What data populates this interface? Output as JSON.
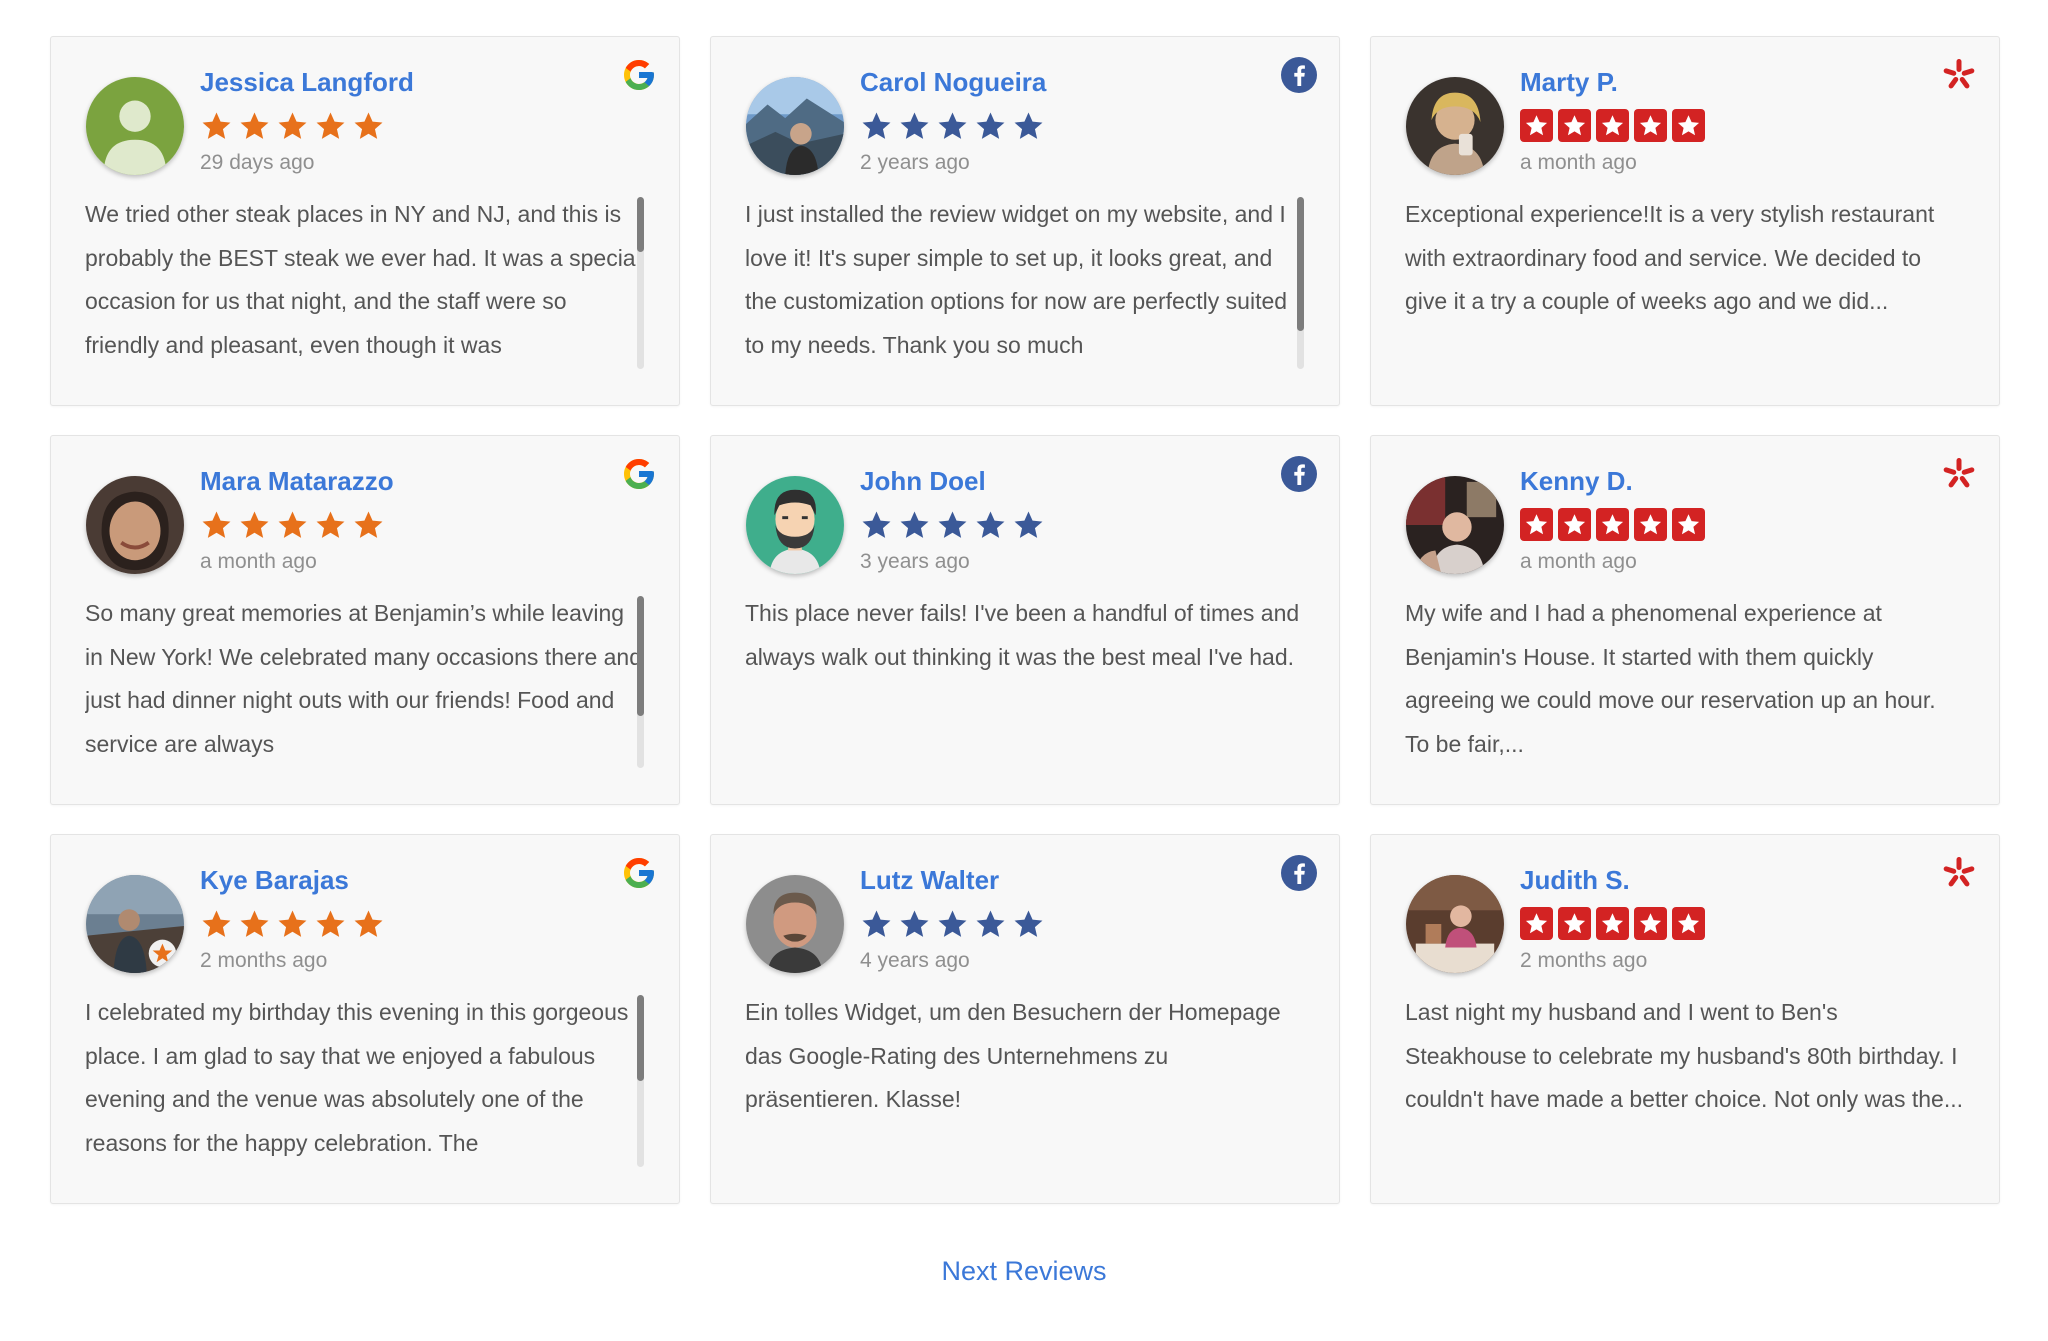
{
  "reviews": [
    {
      "name": "Jessica Langford",
      "date": "29 days ago",
      "platform": "google",
      "text": "We tried other steak places in NY and NJ, and this is probably the BEST steak we ever had. It was a special occasion for us that night, and the staff were so friendly and pleasant, even though it was",
      "scrollable": true,
      "scroll_thumb_fraction": 0.32
    },
    {
      "name": "Carol Nogueira",
      "date": "2 years ago",
      "platform": "facebook",
      "text": "I just installed the review widget on my website, and I love it! It's super simple to set up, it looks great, and the customization options for now are perfectly suited to my needs. Thank you so much",
      "scrollable": true,
      "scroll_thumb_fraction": 0.78
    },
    {
      "name": "Marty P.",
      "date": "a month ago",
      "platform": "yelp",
      "text": "Exceptional experience!It is a very stylish restaurant with extraordinary food and service. We decided to give it a try a couple of weeks ago and we did...",
      "scrollable": false
    },
    {
      "name": "Mara Matarazzo",
      "date": "a month ago",
      "platform": "google",
      "text": "So many great memories at Benjamin’s while leaving in New York! We celebrated many occasions there and just had dinner night outs with our friends! Food and service are always",
      "scrollable": true,
      "scroll_thumb_fraction": 0.7
    },
    {
      "name": "John Doel",
      "date": "3 years ago",
      "platform": "facebook",
      "text": "This place never fails! I've been a handful of times and always walk out thinking it was the best meal I've had.",
      "scrollable": false
    },
    {
      "name": "Kenny D.",
      "date": "a month ago",
      "platform": "yelp",
      "text": "My wife and I had a phenomenal experience at Benjamin's House. It started with them quickly agreeing we could move our reservation up an hour. To be fair,...",
      "scrollable": false
    },
    {
      "name": "Kye Barajas",
      "date": "2 months ago",
      "platform": "google",
      "text": "I celebrated my birthday this evening in this gorgeous place. I am glad to say that we enjoyed a fabulous evening and the venue was absolutely one of the reasons for the happy celebration. The",
      "scrollable": true,
      "scroll_thumb_fraction": 0.5
    },
    {
      "name": "Lutz Walter",
      "date": "4 years ago",
      "platform": "facebook",
      "text": "Ein tolles Widget, um den Besuchern der Homepage das Google-Rating des Unternehmens zu präsentieren. Klasse!",
      "scrollable": false
    },
    {
      "name": "Judith S.",
      "date": "2 months ago",
      "platform": "yelp",
      "text": "Last night my husband and I went to Ben's Steakhouse to celebrate my husband's 80th birthday. I couldn't have made a better choice. Not only was the...",
      "scrollable": false
    }
  ],
  "rating": 5,
  "colors": {
    "name_link": "#3b78d8",
    "google_star": "#e7711b",
    "facebook_star": "#3b5998",
    "yelp_star_bg": "#d32323",
    "text": "#555555",
    "date": "#8f8f8f"
  },
  "pagination": {
    "next_label": "Next Reviews"
  }
}
